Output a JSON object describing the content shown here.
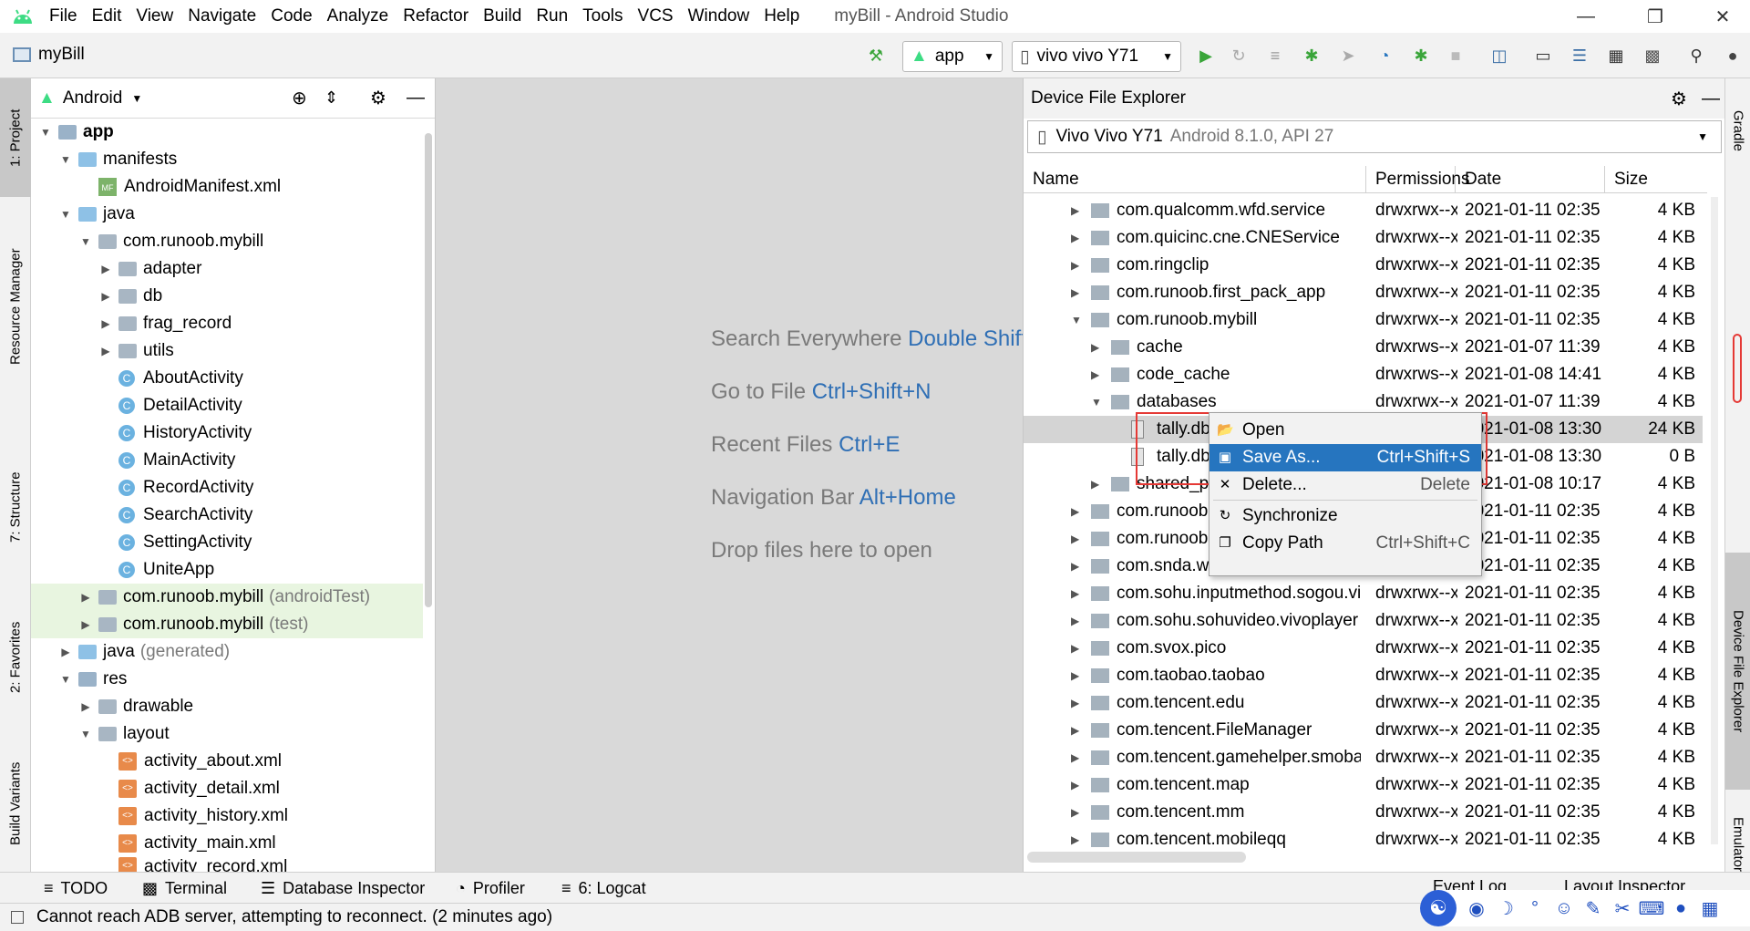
{
  "menu": [
    "File",
    "Edit",
    "View",
    "Navigate",
    "Code",
    "Analyze",
    "Refactor",
    "Build",
    "Run",
    "Tools",
    "VCS",
    "Window",
    "Help"
  ],
  "window_title": "myBill - Android Studio",
  "project_name": "myBill",
  "toolbar": {
    "run_config": "app",
    "device": "vivo vivo Y71"
  },
  "project_panel": {
    "view_mode": "Android",
    "tree": [
      {
        "label": "app",
        "bold": true
      },
      {
        "label": "manifests"
      },
      {
        "label": "AndroidManifest.xml"
      },
      {
        "label": "java"
      },
      {
        "label": "com.runoob.mybill"
      },
      {
        "label": "adapter"
      },
      {
        "label": "db"
      },
      {
        "label": "frag_record"
      },
      {
        "label": "utils"
      },
      {
        "label": "AboutActivity"
      },
      {
        "label": "DetailActivity"
      },
      {
        "label": "HistoryActivity"
      },
      {
        "label": "MainActivity"
      },
      {
        "label": "RecordActivity"
      },
      {
        "label": "SearchActivity"
      },
      {
        "label": "SettingActivity"
      },
      {
        "label": "UniteApp"
      },
      {
        "label": "com.runoob.mybill",
        "suffix": "(androidTest)"
      },
      {
        "label": "com.runoob.mybill",
        "suffix": "(test)"
      },
      {
        "label": "java",
        "suffix": "(generated)"
      },
      {
        "label": "res"
      },
      {
        "label": "drawable"
      },
      {
        "label": "layout"
      },
      {
        "label": "activity_about.xml"
      },
      {
        "label": "activity_detail.xml"
      },
      {
        "label": "activity_history.xml"
      },
      {
        "label": "activity_main.xml"
      },
      {
        "label": "activity_record.xml"
      }
    ]
  },
  "left_tabs": [
    "1: Project",
    "Resource Manager",
    "7: Structure",
    "2: Favorites",
    "Build Variants"
  ],
  "right_tabs": [
    "Gradle",
    "Device File Explorer",
    "Emulator"
  ],
  "editor_hints": [
    {
      "text": "Search Everywhere",
      "key": "Double Shift"
    },
    {
      "text": "Go to File",
      "key": "Ctrl+Shift+N"
    },
    {
      "text": "Recent Files",
      "key": "Ctrl+E"
    },
    {
      "text": "Navigation Bar",
      "key": "Alt+Home"
    },
    {
      "text": "Drop files here to open",
      "key": ""
    }
  ],
  "device_explorer": {
    "title": "Device File Explorer",
    "device_name": "Vivo Vivo Y71",
    "device_detail": "Android 8.1.0, API 27",
    "columns": [
      "Name",
      "Permissions",
      "Date",
      "Size"
    ],
    "rows": [
      {
        "name": "com.qualcomm.wfd.service",
        "perm": "drwxrwx--x",
        "date": "2021-01-11 02:35",
        "size": "4 KB"
      },
      {
        "name": "com.quicinc.cne.CNEService",
        "perm": "drwxrwx--x",
        "date": "2021-01-11 02:35",
        "size": "4 KB"
      },
      {
        "name": "com.ringclip",
        "perm": "drwxrwx--x",
        "date": "2021-01-11 02:35",
        "size": "4 KB"
      },
      {
        "name": "com.runoob.first_pack_app",
        "perm": "drwxrwx--x",
        "date": "2021-01-11 02:35",
        "size": "4 KB"
      },
      {
        "name": "com.runoob.mybill",
        "perm": "drwxrwx--x",
        "date": "2021-01-11 02:35",
        "size": "4 KB"
      },
      {
        "name": "cache",
        "perm": "drwxrws--x",
        "date": "2021-01-07 11:39",
        "size": "4 KB"
      },
      {
        "name": "code_cache",
        "perm": "drwxrws--x",
        "date": "2021-01-08 14:41",
        "size": "4 KB"
      },
      {
        "name": "databases",
        "perm": "drwxrwx--x",
        "date": "2021-01-07 11:39",
        "size": "4 KB"
      },
      {
        "name": "tally.db",
        "perm": "",
        "date": "2021-01-08 13:30",
        "size": "24 KB"
      },
      {
        "name": "tally.db-journal",
        "perm": "",
        "date": "2021-01-08 13:30",
        "size": "0 B"
      },
      {
        "name": "shared_prefs",
        "perm": "",
        "date": "2021-01-08 10:17",
        "size": "4 KB"
      },
      {
        "name": "com.runoob.a",
        "perm": "",
        "date": "2021-01-11 02:35",
        "size": "4 KB"
      },
      {
        "name": "com.runoob.b",
        "perm": "",
        "date": "2021-01-11 02:35",
        "size": "4 KB"
      },
      {
        "name": "com.snda.wifilocating",
        "perm": "",
        "date": "2021-01-11 02:35",
        "size": "4 KB"
      },
      {
        "name": "com.sohu.inputmethod.sogou.vivo",
        "perm": "drwxrwx--x",
        "date": "2021-01-11 02:35",
        "size": "4 KB"
      },
      {
        "name": "com.sohu.sohuvideo.vivoplayer",
        "perm": "drwxrwx--x",
        "date": "2021-01-11 02:35",
        "size": "4 KB"
      },
      {
        "name": "com.svox.pico",
        "perm": "drwxrwx--x",
        "date": "2021-01-11 02:35",
        "size": "4 KB"
      },
      {
        "name": "com.taobao.taobao",
        "perm": "drwxrwx--x",
        "date": "2021-01-11 02:35",
        "size": "4 KB"
      },
      {
        "name": "com.tencent.edu",
        "perm": "drwxrwx--x",
        "date": "2021-01-11 02:35",
        "size": "4 KB"
      },
      {
        "name": "com.tencent.FileManager",
        "perm": "drwxrwx--x",
        "date": "2021-01-11 02:35",
        "size": "4 KB"
      },
      {
        "name": "com.tencent.gamehelper.smoba",
        "perm": "drwxrwx--x",
        "date": "2021-01-11 02:35",
        "size": "4 KB"
      },
      {
        "name": "com.tencent.map",
        "perm": "drwxrwx--x",
        "date": "2021-01-11 02:35",
        "size": "4 KB"
      },
      {
        "name": "com.tencent.mm",
        "perm": "drwxrwx--x",
        "date": "2021-01-11 02:35",
        "size": "4 KB"
      },
      {
        "name": "com.tencent.mobileqq",
        "perm": "drwxrwx--x",
        "date": "2021-01-11 02:35",
        "size": "4 KB"
      }
    ]
  },
  "context_menu": [
    {
      "label": "Open",
      "shortcut": "",
      "icon": "folder-open-icon"
    },
    {
      "label": "Save As...",
      "shortcut": "Ctrl+Shift+S",
      "icon": "save-icon",
      "active": true
    },
    {
      "label": "Delete...",
      "shortcut": "Delete",
      "icon": "delete-icon"
    },
    {
      "label": "Synchronize",
      "shortcut": "",
      "icon": "sync-icon"
    },
    {
      "label": "Copy Path",
      "shortcut": "Ctrl+Shift+C",
      "icon": "copy-icon"
    }
  ],
  "bottom_tabs": [
    "TODO",
    "Terminal",
    "Database Inspector",
    "Profiler",
    "6: Logcat",
    "Event Log",
    "Layout Inspector"
  ],
  "status_message": "Cannot reach ADB server, attempting to reconnect. (2 minutes ago)",
  "colors": {
    "accent": "#2675bf",
    "highlight_box": "#e53935",
    "run_green": "#3aa53a"
  }
}
